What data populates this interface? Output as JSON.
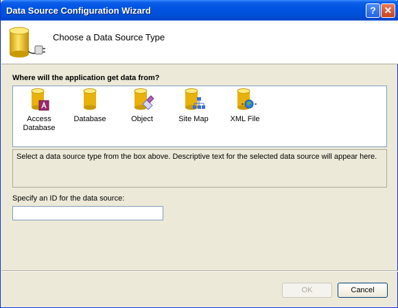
{
  "window": {
    "title": "Data Source Configuration Wizard",
    "help_button": "?",
    "close_button": "✕"
  },
  "header": {
    "title": "Choose a Data Source Type"
  },
  "question": "Where will the application get data from?",
  "data_sources": [
    {
      "label_line1": "Access",
      "label_line2": "Database",
      "icon": "access-database-icon"
    },
    {
      "label_line1": "Database",
      "label_line2": "",
      "icon": "database-icon"
    },
    {
      "label_line1": "Object",
      "label_line2": "",
      "icon": "object-icon"
    },
    {
      "label_line1": "Site Map",
      "label_line2": "",
      "icon": "site-map-icon"
    },
    {
      "label_line1": "XML File",
      "label_line2": "",
      "icon": "xml-file-icon"
    }
  ],
  "description": "Select a data source type from the box above. Descriptive text for the selected data source will appear here.",
  "id_field": {
    "label": "Specify an ID for the data source:",
    "value": ""
  },
  "buttons": {
    "ok": "OK",
    "cancel": "Cancel"
  },
  "colors": {
    "title_bar": "#0054e3",
    "dialog_bg": "#ece9d8",
    "cylinder": "#f2c41a"
  }
}
